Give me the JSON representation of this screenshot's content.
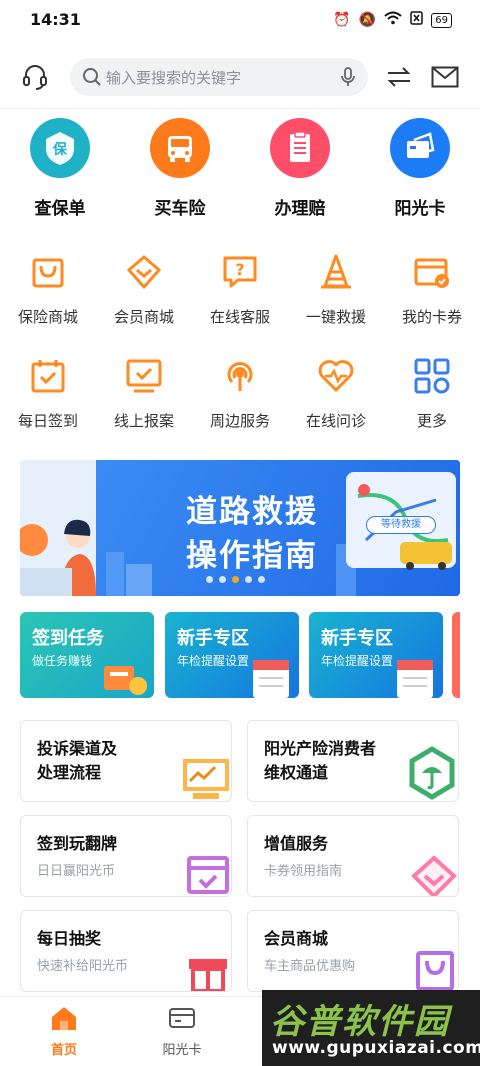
{
  "status": {
    "time": "14:31",
    "battery": "69"
  },
  "header": {
    "search_placeholder": "输入要搜索的关键字"
  },
  "big_items": [
    {
      "label": "查保单",
      "icon": "policy-shield-icon",
      "color": "#1fb2c7"
    },
    {
      "label": "买车险",
      "icon": "car-icon",
      "color": "#ff7a1a"
    },
    {
      "label": "办理赔",
      "icon": "claim-document-icon",
      "color": "#ff4e6a"
    },
    {
      "label": "阳光卡",
      "icon": "sunshine-card-icon",
      "color": "#1b7cf5"
    }
  ],
  "row1": [
    {
      "label": "保险商城"
    },
    {
      "label": "会员商城"
    },
    {
      "label": "在线客服"
    },
    {
      "label": "一键救援"
    },
    {
      "label": "我的卡券"
    }
  ],
  "row2": [
    {
      "label": "每日签到"
    },
    {
      "label": "线上报案"
    },
    {
      "label": "周边服务"
    },
    {
      "label": "在线问诊"
    },
    {
      "label": "更多"
    }
  ],
  "banner": {
    "line1": "道路救援",
    "line2": "操作指南",
    "pill": "等待救援"
  },
  "tasks": [
    {
      "title": "签到任务",
      "sub": "做任务赚钱"
    },
    {
      "title": "新手专区",
      "sub": "年检提醒设置"
    },
    {
      "title": "新手专区",
      "sub": "年检提醒设置"
    }
  ],
  "features": [
    {
      "title": "投诉渠道及\n处理流程",
      "sub": ""
    },
    {
      "title": "阳光产险消费者\n维权通道",
      "sub": ""
    },
    {
      "title": "签到玩翻牌",
      "sub": "日日赢阳光币"
    },
    {
      "title": "增值服务",
      "sub": "卡券领用指南"
    },
    {
      "title": "每日抽奖",
      "sub": "快速补给阳光币"
    },
    {
      "title": "会员商城",
      "sub": "车主商品优惠购"
    }
  ],
  "tabbar": [
    {
      "label": "首页"
    },
    {
      "label": "阳光卡"
    }
  ],
  "watermark": {
    "title": "谷普软件园",
    "url": "www.gupuxiazai.com"
  },
  "colors": {
    "accent": "#ff7a1a",
    "primary_blue": "#1b7cf5"
  }
}
